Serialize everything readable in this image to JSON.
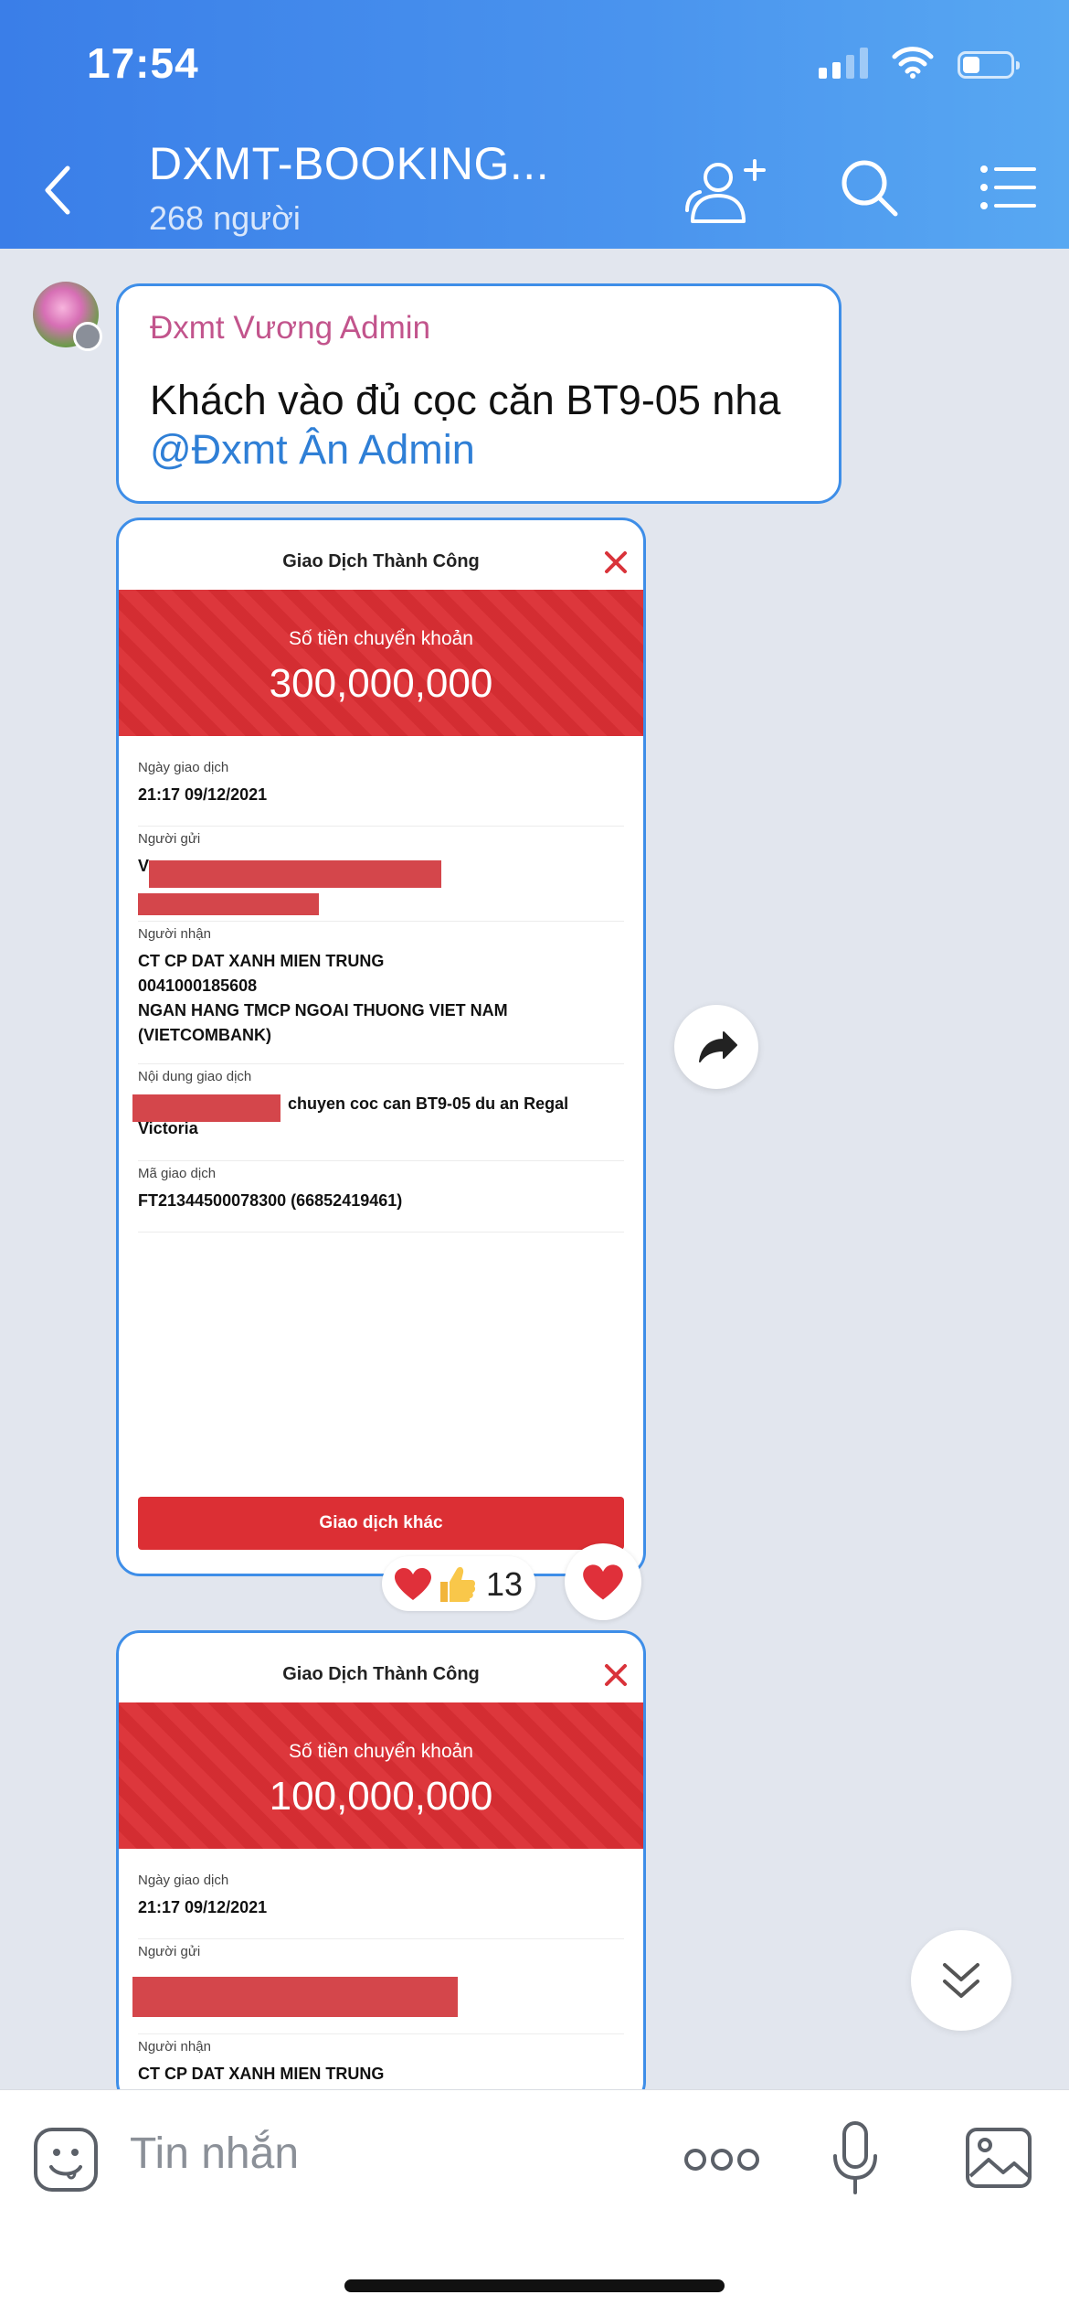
{
  "status_bar": {
    "time": "17:54"
  },
  "header": {
    "title": "DXMT-BOOKING...",
    "member_count": "268 người"
  },
  "message": {
    "sender": "Đxmt Vương Admin",
    "text": "Khách vào đủ cọc căn BT9-05 nha",
    "mention": "@Đxmt Ân Admin"
  },
  "receipt1": {
    "title": "Giao Dịch Thành Công",
    "amount_label": "Số tiền chuyển khoản",
    "amount": "300,000,000",
    "date_label": "Ngày giao dịch",
    "date": "21:17 09/12/2021",
    "sender_label": "Người gửi",
    "sender_visible": "V",
    "receiver_label": "Người nhận",
    "receiver_name": "CT CP DAT XANH MIEN TRUNG",
    "receiver_account": "0041000185608",
    "receiver_bank": "NGAN HANG TMCP NGOAI THUONG VIET NAM (VIETCOMBANK)",
    "content_label": "Nội dung giao dịch",
    "content": "chuyen coc can BT9-05 du an Regal Victoria",
    "code_label": "Mã giao dịch",
    "code": "FT21344500078300 (66852419461)",
    "button": "Giao dịch khác"
  },
  "reactions": {
    "emojis": "❤️👍",
    "count": "13",
    "react_button": "❤️"
  },
  "receipt2": {
    "title": "Giao Dịch Thành Công",
    "amount_label": "Số tiền chuyển khoản",
    "amount": "100,000,000",
    "date_label": "Ngày giao dịch",
    "date": "21:17 09/12/2021",
    "sender_label": "Người gửi",
    "receiver_label": "Người nhận",
    "receiver_name": "CT CP DAT XANH MIEN TRUNG"
  },
  "input": {
    "placeholder": "Tin nhắn"
  },
  "colors": {
    "header_blue": "#4a94ee",
    "receipt_red": "#dc2f34",
    "bubble_border": "#3e8ee8",
    "sender_pink": "#c2548c",
    "mention_blue": "#2f7fd6"
  }
}
